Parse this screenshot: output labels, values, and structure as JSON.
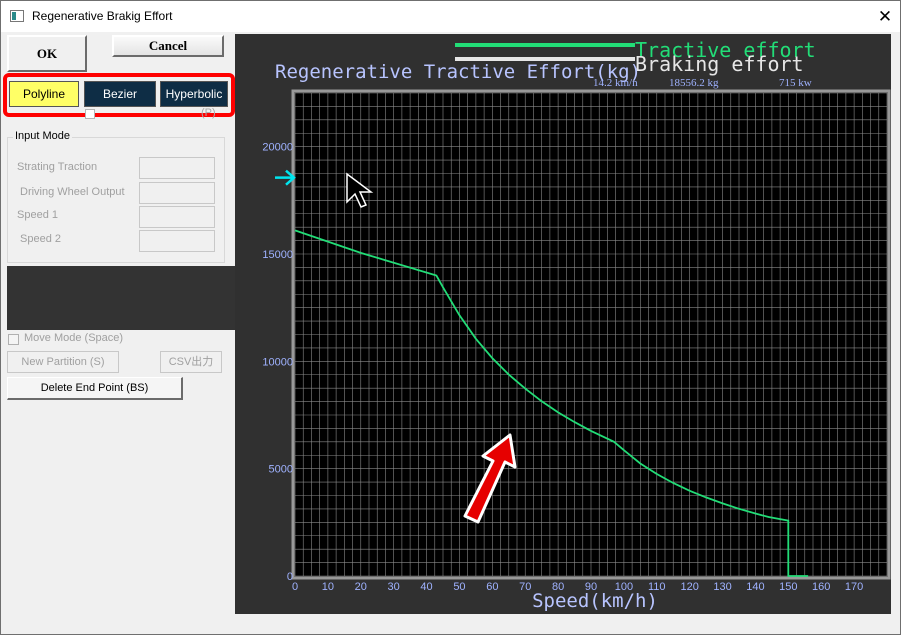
{
  "window": {
    "title": "Regenerative Brakig Effort",
    "close_glyph": "✕"
  },
  "buttons": {
    "ok": "OK",
    "cancel": "Cancel"
  },
  "mode_tabs": [
    {
      "label": "Polyline",
      "selected": true,
      "bg": "#ffff66"
    },
    {
      "label": "Bezier",
      "selected": false,
      "bg": "#0e2d45"
    },
    {
      "label": "Hyperbolic",
      "selected": false,
      "bg": "#0e2d45"
    }
  ],
  "hidden_option": {
    "suffix": "(P)"
  },
  "input_mode": {
    "legend": "Input Mode",
    "fields": [
      {
        "label": "Strating Traction",
        "value": ""
      },
      {
        "label": "Driving Wheel Output",
        "value": ""
      },
      {
        "label": "Speed 1",
        "value": ""
      },
      {
        "label": "Speed 2",
        "value": ""
      }
    ]
  },
  "move_mode": {
    "label": "Move Mode (Space)",
    "checked": false
  },
  "actions": {
    "new_partition": "New Partition (S)",
    "csv": "CSV出力",
    "delete_end_point": "Delete End Point (BS)"
  },
  "chart_data": {
    "type": "line",
    "title": "Regenerative Tractive Effort(kg)",
    "xlabel": "Speed(km/h)",
    "ylabel": "",
    "xlim": [
      0,
      180
    ],
    "ylim": [
      0,
      22500
    ],
    "x_ticks": [
      0,
      10,
      20,
      30,
      40,
      50,
      60,
      70,
      80,
      90,
      100,
      110,
      120,
      130,
      140,
      150,
      160,
      170
    ],
    "y_ticks": [
      0,
      5000,
      10000,
      15000,
      20000
    ],
    "grid": true,
    "background": "#000000",
    "legend_position": "top",
    "legend": [
      {
        "label": "Tractive effort",
        "color": "#22dd77"
      },
      {
        "label": "Braking effort",
        "color": "#e6e6e6"
      }
    ],
    "readout": {
      "speed": "14.2 km/n",
      "force": "18556.2 kg",
      "power": "715 kw"
    },
    "series": [
      {
        "name": "Tractive effort",
        "color": "#22dd77",
        "points": [
          [
            0,
            16100
          ],
          [
            20,
            15050
          ],
          [
            43,
            14000
          ],
          [
            45,
            13450
          ],
          [
            50,
            12150
          ],
          [
            55,
            11050
          ],
          [
            60,
            10150
          ],
          [
            65,
            9380
          ],
          [
            70,
            8730
          ],
          [
            75,
            8140
          ],
          [
            80,
            7620
          ],
          [
            85,
            7170
          ],
          [
            90,
            6760
          ],
          [
            97,
            6250
          ],
          [
            100,
            5860
          ],
          [
            105,
            5240
          ],
          [
            110,
            4750
          ],
          [
            115,
            4330
          ],
          [
            120,
            3970
          ],
          [
            125,
            3660
          ],
          [
            130,
            3380
          ],
          [
            135,
            3130
          ],
          [
            140,
            2910
          ],
          [
            144,
            2750
          ],
          [
            150,
            2580
          ],
          [
            150,
            0
          ],
          [
            156,
            0
          ]
        ]
      }
    ],
    "marker_y": 18556.2,
    "marker_color": "#00e5ee"
  }
}
